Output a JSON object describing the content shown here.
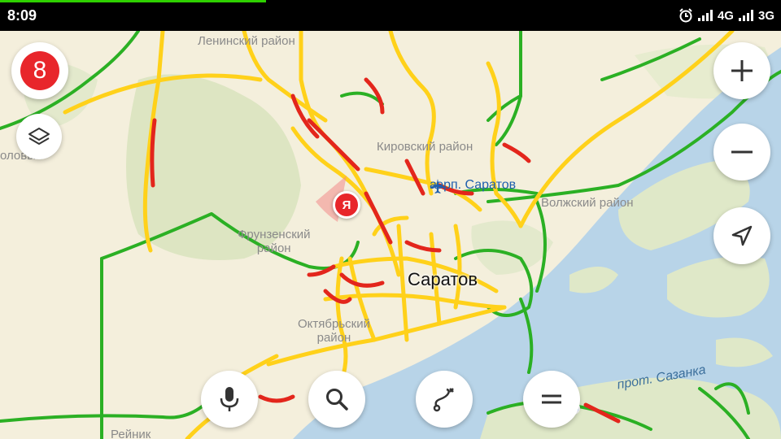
{
  "status_bar": {
    "time": "8:09",
    "network_1": "4G",
    "network_2": "3G",
    "alarm_icon": "alarm-clock-icon"
  },
  "traffic": {
    "level": "8"
  },
  "map": {
    "district_labels": {
      "leninsky": "Ленинский район",
      "kirovsky": "Кировский район",
      "volzhsky": "Волжский район",
      "frunzensky_line1": "Фрунзенский",
      "frunzensky_line2": "район",
      "oktyabrsky_line1": "Октябрьский",
      "oktyabrsky_line2": "район",
      "edge_left": "оловый",
      "reinik": "Рейник"
    },
    "city": "Саратов",
    "airport": "аэрп. Саратов",
    "water": "прот. Сазанка",
    "pin_letter": "Я"
  },
  "controls": {
    "zoom_in_icon": "plus-icon",
    "zoom_out_icon": "minus-icon",
    "locate_icon": "navigation-arrow-icon",
    "layers_icon": "layers-icon",
    "voice_icon": "microphone-icon",
    "search_icon": "search-icon",
    "route_icon": "route-icon",
    "menu_icon": "menu-icon"
  },
  "colors": {
    "land": "#f4efdc",
    "water": "#b8d4e8",
    "forest": "#dde5c2",
    "traffic_green": "#2bb024",
    "traffic_yellow": "#ffd11a",
    "traffic_red": "#e3261c",
    "accent_red": "#e8262b"
  }
}
